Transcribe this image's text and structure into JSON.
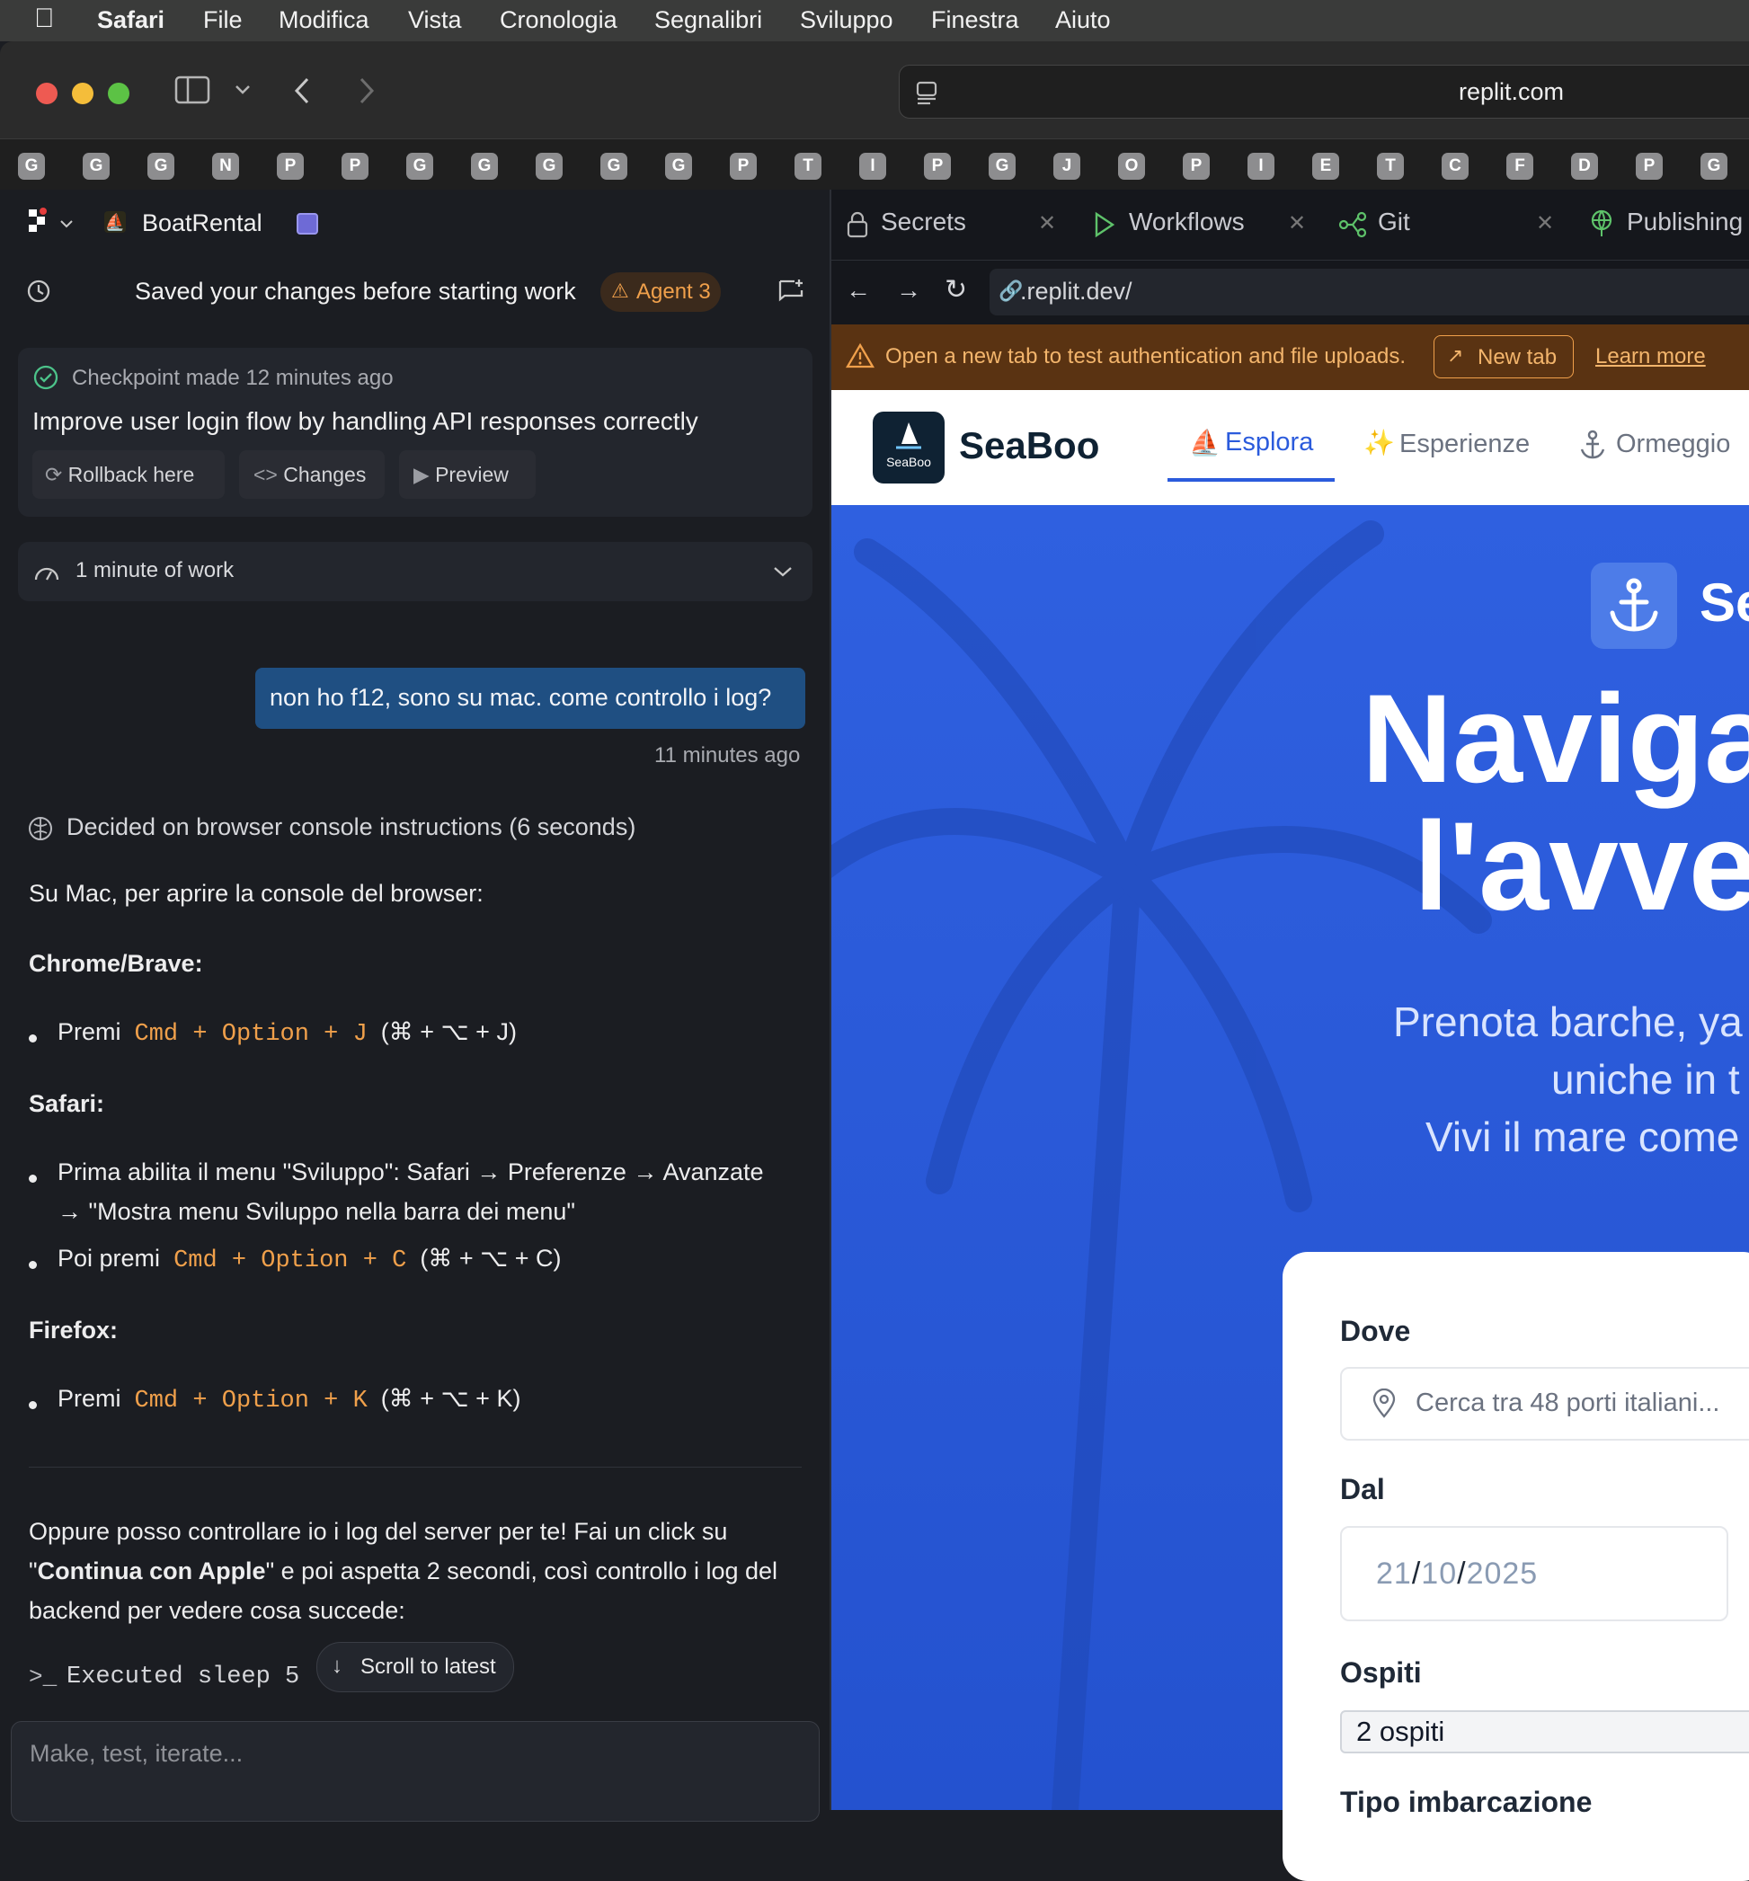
{
  "menubar": {
    "app": "Safari",
    "items": [
      "File",
      "Modifica",
      "Vista",
      "Cronologia",
      "Segnalibri",
      "Sviluppo",
      "Finestra",
      "Aiuto"
    ]
  },
  "browser": {
    "url": "replit.com",
    "favorites": [
      "G",
      "G",
      "G",
      "N",
      "P",
      "P",
      "G",
      "G",
      "G",
      "G",
      "G",
      "P",
      "T",
      "I",
      "P",
      "G",
      "J",
      "O",
      "P",
      "I",
      "E",
      "T",
      "C",
      "F",
      "D",
      "P",
      "G"
    ]
  },
  "project": {
    "name": "BoatRental"
  },
  "chat": {
    "header": "Saved your changes before starting work",
    "agent_badge": "Agent 3",
    "checkpoint": {
      "time": "Checkpoint made 12 minutes ago",
      "title": "Improve user login flow by handling API responses correctly",
      "buttons": [
        "Rollback here",
        "Changes",
        "Preview"
      ]
    },
    "work": "1 minute of work",
    "user_message": "non ho f12, sono su mac. come controllo i log?",
    "user_time": "11 minutes ago",
    "decided": "Decided on browser console instructions (6 seconds)",
    "intro": "Su Mac, per aprire la console del browser:",
    "chrome_heading": "Chrome/Brave:",
    "chrome_premi": "Premi",
    "chrome_code": "Cmd + Option + J",
    "chrome_symbols": "(⌘ + ⌥ + J)",
    "safari_heading": "Safari:",
    "safari_line1": "Prima abilita il menu \"Sviluppo\": Safari → Preferenze → Avanzate",
    "safari_line2": "→ \"Mostra menu Sviluppo nella barra dei menu\"",
    "safari_poi": "Poi premi",
    "safari_code": "Cmd + Option + C",
    "safari_symbols": "(⌘ + ⌥ + C)",
    "firefox_heading": "Firefox:",
    "firefox_premi": "Premi",
    "firefox_code": "Cmd + Option + K",
    "firefox_symbols": "(⌘ + ⌥ + K)",
    "outro1_a": "Oppure posso controllare io i log del server per te! Fai un click su",
    "outro2_q1": "\"",
    "outro2_bold": "Continua con Apple",
    "outro2_rest": "\" e poi aspetta 2 secondi, così controllo i log del",
    "outro3": "backend per vedere cosa succede:",
    "executed": "Executed sleep 5",
    "scroll_latest": "Scroll to latest",
    "input_placeholder": "Make, test, iterate..."
  },
  "tabs": [
    "Secrets",
    "Workflows",
    "Git",
    "Publishing"
  ],
  "preview": {
    "url": ".replit.dev/",
    "warning": "Open a new tab to test authentication and file uploads.",
    "new_tab": "New tab",
    "learn_more": "Learn more"
  },
  "site": {
    "logo_text": "SeaBoo",
    "brand": "SeaBoo",
    "nav": [
      "Esplora",
      "Esperienze",
      "Ormeggio"
    ],
    "hero_badge_text": "Se",
    "hero_line1": "Naviga",
    "hero_line2": "l'avve",
    "sub1": "Prenota barche, ya",
    "sub2": "uniche in t",
    "sub3": "Vivi il mare come",
    "form": {
      "dove_label": "Dove",
      "dove_placeholder": "Cerca tra 48 porti italiani...",
      "dal_label": "Dal",
      "date_dd": "21",
      "date_mm": "10",
      "date_yyyy": "2025",
      "ospiti_label": "Ospiti",
      "ospiti_value": "2 ospiti",
      "tipo_label": "Tipo imbarcazione"
    }
  },
  "colors": {
    "accent": "#2b5bdc",
    "code": "#f0a04b",
    "warning_bg": "#5a3312",
    "user_bubble": "#1f4f82"
  }
}
